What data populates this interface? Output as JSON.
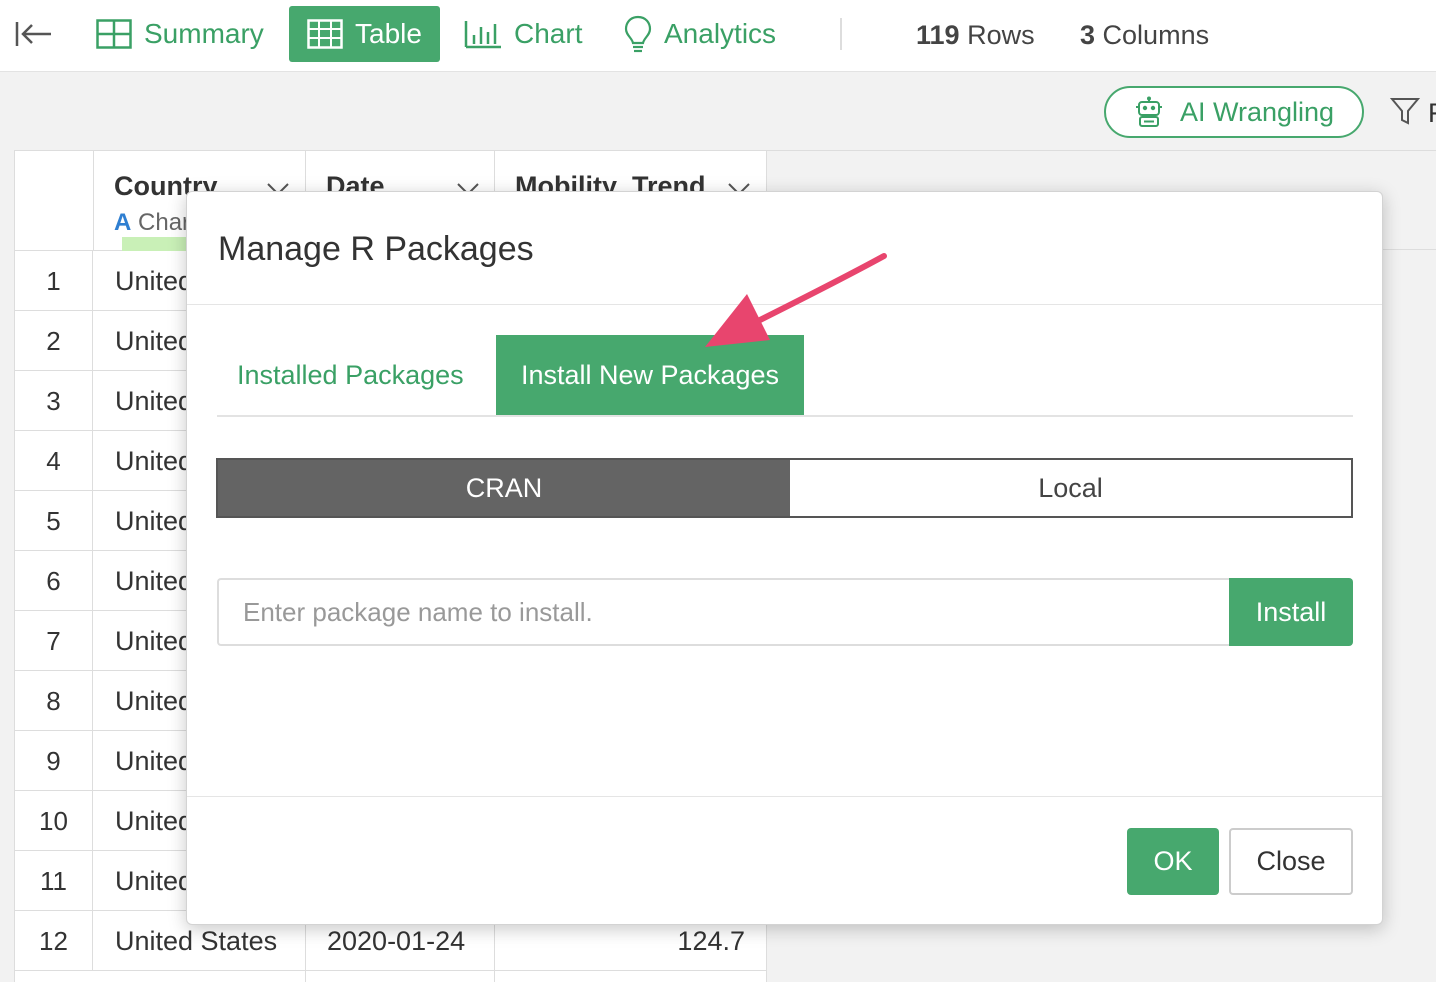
{
  "toolbar": {
    "tabs": [
      {
        "label": "Summary",
        "icon": "summary-grid-icon",
        "active": false
      },
      {
        "label": "Table",
        "icon": "table-icon",
        "active": true
      },
      {
        "label": "Chart",
        "icon": "bar-chart-icon",
        "active": false
      },
      {
        "label": "Analytics",
        "icon": "lightbulb-icon",
        "active": false
      }
    ],
    "rows_count": "119",
    "rows_label": "Rows",
    "columns_count": "3",
    "columns_label": "Columns"
  },
  "actions": {
    "ai_wrangling_label": "AI Wrangling",
    "filter_label": "F"
  },
  "table": {
    "columns": [
      {
        "name": "Country",
        "type_icon": "A",
        "type": "Char"
      },
      {
        "name": "Date",
        "type_icon": "",
        "type": ""
      },
      {
        "name": "Mobility_Trend",
        "type_icon": "",
        "type": ""
      }
    ],
    "rows": [
      {
        "num": "1",
        "country": "United",
        "date": "",
        "trend": ""
      },
      {
        "num": "2",
        "country": "United",
        "date": "",
        "trend": ""
      },
      {
        "num": "3",
        "country": "United",
        "date": "",
        "trend": ""
      },
      {
        "num": "4",
        "country": "United",
        "date": "",
        "trend": ""
      },
      {
        "num": "5",
        "country": "United",
        "date": "",
        "trend": ""
      },
      {
        "num": "6",
        "country": "United",
        "date": "",
        "trend": ""
      },
      {
        "num": "7",
        "country": "United",
        "date": "",
        "trend": ""
      },
      {
        "num": "8",
        "country": "United",
        "date": "",
        "trend": ""
      },
      {
        "num": "9",
        "country": "United",
        "date": "",
        "trend": ""
      },
      {
        "num": "10",
        "country": "United",
        "date": "",
        "trend": ""
      },
      {
        "num": "11",
        "country": "United",
        "date": "",
        "trend": ""
      },
      {
        "num": "12",
        "country": "United States",
        "date": "2020-01-24",
        "trend": "124.7"
      }
    ]
  },
  "modal": {
    "title": "Manage R Packages",
    "tabs": {
      "installed": "Installed Packages",
      "install_new": "Install New Packages"
    },
    "source": {
      "cran": "CRAN",
      "local": "Local"
    },
    "input": {
      "placeholder": "Enter package name to install.",
      "value": ""
    },
    "install_label": "Install",
    "ok_label": "OK",
    "close_label": "Close"
  },
  "colors": {
    "accent": "#47a86e",
    "segment_active": "#646464",
    "annotation_arrow": "#e8456e"
  }
}
